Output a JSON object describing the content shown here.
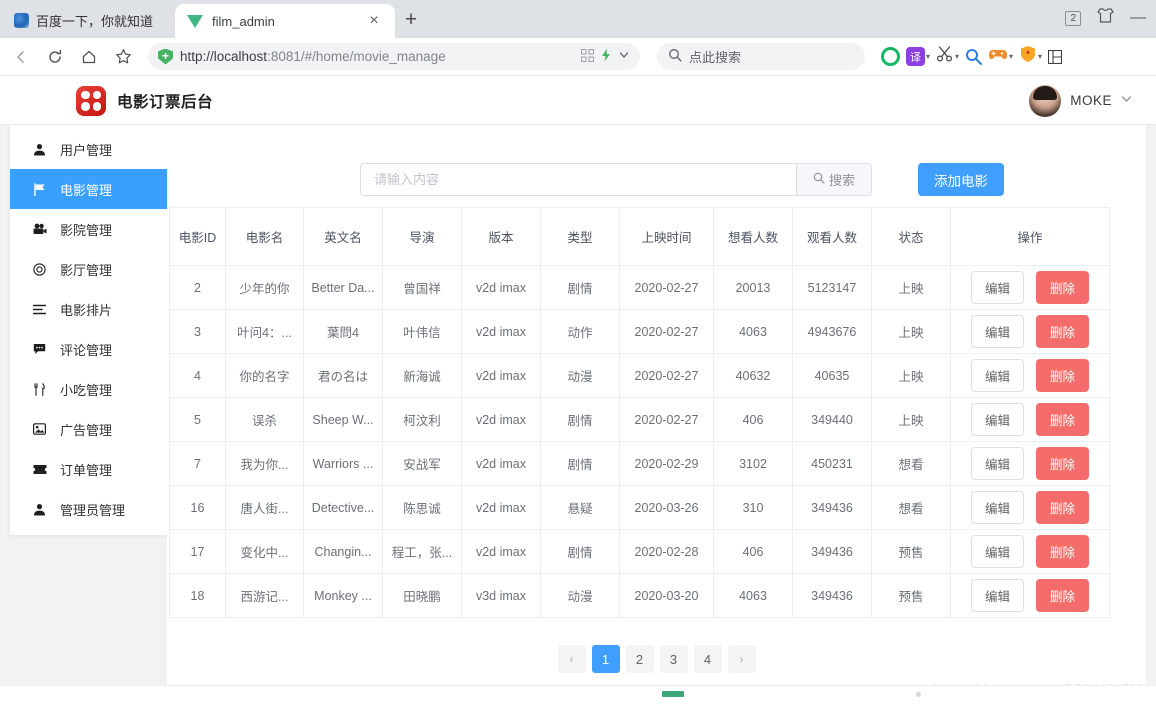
{
  "browser": {
    "bookmark": {
      "label": "百度一下，你就知道",
      "icon": "baidu-favicon"
    },
    "tab": {
      "title": "film_admin",
      "favicon": "vue-logo-icon",
      "close": "×"
    },
    "new_tab_label": "+",
    "window": {
      "tab_count_badge": "2",
      "minimize": "—"
    },
    "toolbar": {
      "reload_icon": "reload-icon",
      "home_icon": "home-icon",
      "bookmark_star_icon": "star-icon",
      "url_scheme": "http://",
      "url_host": "localhost",
      "url_rest": ":8081/#/home/movie_manage",
      "search_placeholder": "点此搜索",
      "ext_translate": "译"
    }
  },
  "app": {
    "brand_title": "电影订票后台",
    "logo_icon": "app-logo-icon",
    "user": {
      "name": "MOKE",
      "avatar_icon": "user-avatar",
      "caret_icon": "chevron-down-icon"
    }
  },
  "sidebar": {
    "items": [
      {
        "label": "用户管理",
        "icon": "user-icon",
        "active": false
      },
      {
        "label": "电影管理",
        "icon": "flag-icon",
        "active": true
      },
      {
        "label": "影院管理",
        "icon": "video-camera-icon",
        "active": false
      },
      {
        "label": "影厅管理",
        "icon": "target-icon",
        "active": false
      },
      {
        "label": "电影排片",
        "icon": "list-icon",
        "active": false
      },
      {
        "label": "评论管理",
        "icon": "comment-icon",
        "active": false
      },
      {
        "label": "小吃管理",
        "icon": "fork-knife-icon",
        "active": false
      },
      {
        "label": "广告管理",
        "icon": "picture-icon",
        "active": false
      },
      {
        "label": "订单管理",
        "icon": "ticket-icon",
        "active": false
      },
      {
        "label": "管理员管理",
        "icon": "admin-user-icon",
        "active": false
      }
    ]
  },
  "toolbar": {
    "search_placeholder": "请输入内容",
    "search_value": "",
    "search_button": "搜索",
    "search_icon": "search-icon",
    "add_button": "添加电影"
  },
  "table": {
    "columns": [
      "电影ID",
      "电影名",
      "英文名",
      "导演",
      "版本",
      "类型",
      "上映时间",
      "想看人数",
      "观看人数",
      "状态",
      "操作"
    ],
    "rows": [
      {
        "id": "2",
        "name": "少年的你",
        "en": "Better Da...",
        "director": "曾国祥",
        "version": "v2d imax",
        "type": "剧情",
        "date": "2020-02-27",
        "want": "20013",
        "watch": "5123147",
        "state": "上映"
      },
      {
        "id": "3",
        "name": "叶问4：...",
        "en": "葉問4",
        "director": "叶伟信",
        "version": "v2d imax",
        "type": "动作",
        "date": "2020-02-27",
        "want": "4063",
        "watch": "4943676",
        "state": "上映"
      },
      {
        "id": "4",
        "name": "你的名字",
        "en": "君の名は",
        "director": "新海诚",
        "version": "v2d imax",
        "type": "动漫",
        "date": "2020-02-27",
        "want": "40632",
        "watch": "40635",
        "state": "上映"
      },
      {
        "id": "5",
        "name": "误杀",
        "en": "Sheep W...",
        "director": "柯汶利",
        "version": "v2d imax",
        "type": "剧情",
        "date": "2020-02-27",
        "want": "406",
        "watch": "349440",
        "state": "上映"
      },
      {
        "id": "7",
        "name": "我为你...",
        "en": "Warriors ...",
        "director": "安战军",
        "version": "v2d imax",
        "type": "剧情",
        "date": "2020-02-29",
        "want": "3102",
        "watch": "450231",
        "state": "想看"
      },
      {
        "id": "16",
        "name": "唐人街...",
        "en": "Detective...",
        "director": "陈思诚",
        "version": "v2d imax",
        "type": "悬疑",
        "date": "2020-03-26",
        "want": "310",
        "watch": "349436",
        "state": "想看"
      },
      {
        "id": "17",
        "name": "变化中...",
        "en": "Changin...",
        "director": "程工，张...",
        "version": "v2d imax",
        "type": "剧情",
        "date": "2020-02-28",
        "want": "406",
        "watch": "349436",
        "state": "预售"
      },
      {
        "id": "18",
        "name": "西游记...",
        "en": "Monkey ...",
        "director": "田晓鹏",
        "version": "v3d imax",
        "type": "动漫",
        "date": "2020-03-20",
        "want": "4063",
        "watch": "349436",
        "state": "预售"
      }
    ],
    "actions": {
      "edit": "编辑",
      "delete": "删除"
    }
  },
  "pagination": {
    "prev_icon": "chevron-left-icon",
    "next_icon": "chevron-right-icon",
    "pages": [
      "1",
      "2",
      "3",
      "4"
    ],
    "current": "1"
  },
  "watermark": "https://blog.csdn.net/QQ344245001",
  "colors": {
    "accent_blue": "#409eff",
    "sidebar_active": "#3aa0ff",
    "danger_red": "#f56c6c",
    "logo_red": "#c2150e",
    "vue_green": "#41b883"
  }
}
